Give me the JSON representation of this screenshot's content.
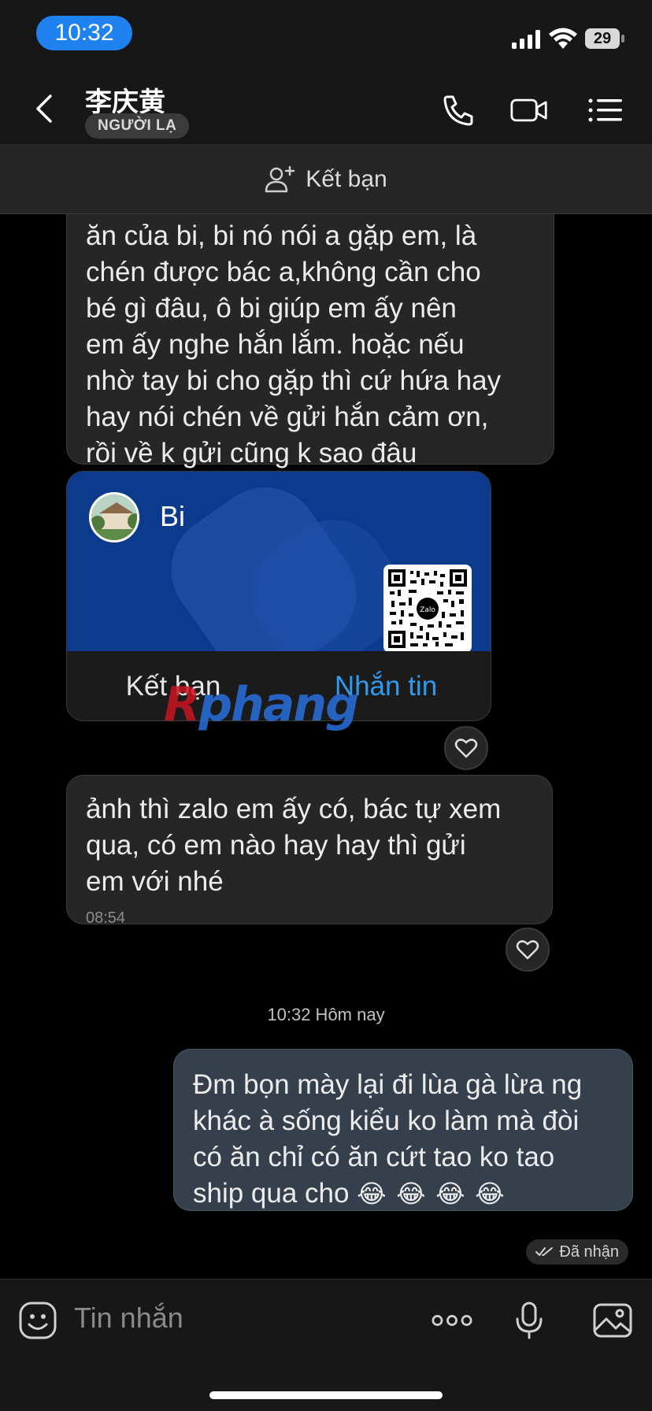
{
  "status_bar": {
    "time": "10:32",
    "battery": "29"
  },
  "header": {
    "name": "李庆黄",
    "badge": "NGƯỜI LẠ",
    "actions": [
      "phone-icon",
      "video-call-icon",
      "menu-icon"
    ]
  },
  "add_friend_bar": {
    "label": "Kết bạn"
  },
  "messages": [
    {
      "lines": [
        "ăn của bi, bi nó nói a gặp em, là",
        "chén được bác a,không cần cho",
        "bé gì đâu,  ô bi giúp em ấy nên",
        "em ấy nghe hắn lắm. hoặc nếu",
        "nhờ tay bi cho gặp thì cứ hứa hay",
        "hay nói chén về gửi hắn cảm ơn,",
        "rồi về k gửi cũng k sao đâu"
      ]
    },
    {
      "card": {
        "name": "Bi",
        "qr_label": "Zalo",
        "add_friend": "Kết bạn",
        "message": "Nhắn tin"
      }
    },
    {
      "lines": [
        "ảnh thì zalo em ấy có, bác tự xem",
        "qua, có em nào hay hay thì gửi",
        "em với nhé"
      ],
      "time": "08:54"
    },
    {
      "lines": [
        "Đm bọn mày lại đi lùa gà lừa ng",
        "khác à sống kiểu ko làm mà đòi",
        "có ăn chỉ có ăn cứt tao ko tao",
        "ship qua cho"
      ],
      "emoji": [
        "😂",
        "😂",
        "😂",
        "😂"
      ],
      "status": "Đã nhận"
    }
  ],
  "day_separator": "10:32 Hôm nay",
  "watermark": {
    "first": "R",
    "rest": "phang"
  },
  "composer": {
    "placeholder": "Tin nhắn"
  },
  "colors": {
    "accent": "#1e82f0",
    "card_blue": "#0c3a8c",
    "link": "#2f9bf0",
    "sent_bubble": "#36404d"
  }
}
